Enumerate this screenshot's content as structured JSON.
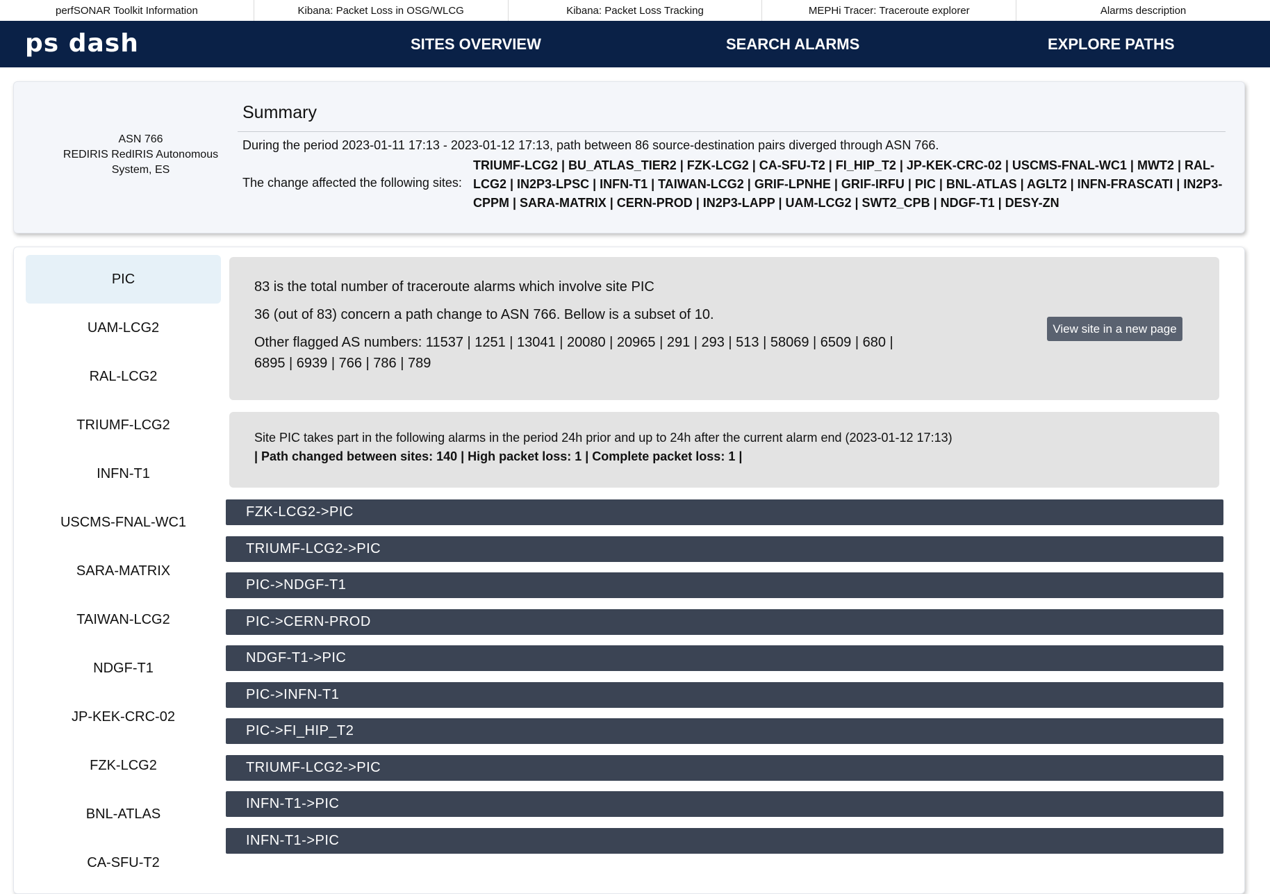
{
  "top_links": [
    "perfSONAR Toolkit Information",
    "Kibana: Packet Loss in OSG/WLCG",
    "Kibana: Packet Loss Tracking",
    "MEPHi Tracer: Traceroute explorer",
    "Alarms description"
  ],
  "nav": {
    "logo": "ps dash",
    "items": [
      "SITES OVERVIEW",
      "SEARCH ALARMS",
      "EXPLORE PATHS"
    ]
  },
  "summary": {
    "asn_number": "ASN 766",
    "asn_name": "REDIRIS RedIRIS Autonomous System, ES",
    "title": "Summary",
    "period_text": "During the period 2023-01-11 17:13 - 2023-01-12 17:13, path between 86 source-destination pairs diverged through ASN 766.",
    "affected_label": "The change affected the following sites:",
    "affected_sites": "TRIUMF-LCG2 | BU_ATLAS_TIER2 | FZK-LCG2 | CA-SFU-T2 | FI_HIP_T2 | JP-KEK-CRC-02 | USCMS-FNAL-WC1 | MWT2 | RAL-LCG2 | IN2P3-LPSC | INFN-T1 | TAIWAN-LCG2 | GRIF-LPNHE | GRIF-IRFU | PIC | BNL-ATLAS | AGLT2 | INFN-FRASCATI | IN2P3-CPPM | SARA-MATRIX | CERN-PROD | IN2P3-LAPP | UAM-LCG2 | SWT2_CPB | NDGF-T1 | DESY-ZN"
  },
  "sidebar": {
    "active_index": 0,
    "items": [
      "PIC",
      "UAM-LCG2",
      "RAL-LCG2",
      "TRIUMF-LCG2",
      "INFN-T1",
      "USCMS-FNAL-WC1",
      "SARA-MATRIX",
      "TAIWAN-LCG2",
      "NDGF-T1",
      "JP-KEK-CRC-02",
      "FZK-LCG2",
      "BNL-ATLAS",
      "CA-SFU-T2"
    ]
  },
  "site_info": {
    "total_text": "83 is the total number of traceroute alarms which involve site PIC",
    "subset_text": "36 (out of 83) concern a path change to ASN 766. Bellow is a subset of 10.",
    "other_as_line1": "Other flagged AS numbers: 11537 | 1251 | 13041 | 20080 | 20965 | 291 | 293 | 513 | 58069 | 6509 | 680 |",
    "other_as_line2": "6895 | 6939 | 766 | 786 | 789",
    "view_button": "View site in a new page"
  },
  "alarms_info": {
    "line1": "Site PIC takes part in the following alarms in the period 24h prior and up to 24h after the current alarm end (2023-01-12 17:13)",
    "line2": "| Path changed between sites: 140 | High packet loss: 1 | Complete packet loss: 1 |"
  },
  "paths": [
    "FZK-LCG2->PIC",
    "TRIUMF-LCG2->PIC",
    "PIC->NDGF-T1",
    "PIC->CERN-PROD",
    "NDGF-T1->PIC",
    "PIC->INFN-T1",
    "PIC->FI_HIP_T2",
    "TRIUMF-LCG2->PIC",
    "INFN-T1->PIC",
    "INFN-T1->PIC"
  ],
  "colors": {
    "nav_bg": "#0a2147",
    "path_bar_bg": "#3b4454",
    "info_bg": "#e3e3e3",
    "active_item_bg": "#e6f1f8",
    "button_bg": "#5a6270"
  }
}
